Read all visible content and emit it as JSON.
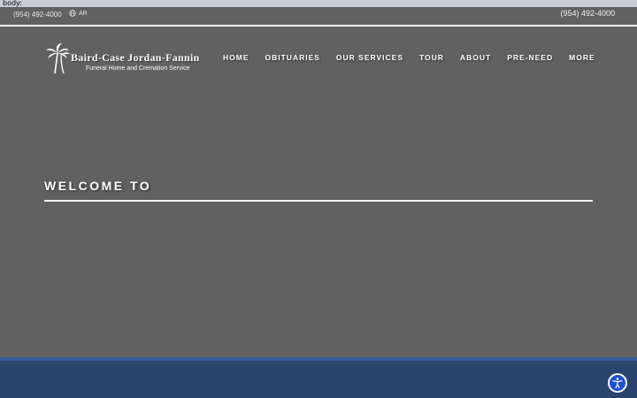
{
  "debug_label": "body:",
  "topbar": {
    "phone_left": "(954) 492-4000",
    "language": "AR",
    "phone_right": "(954) 492-4000"
  },
  "logo": {
    "name": "Baird-Case Jordan-Fannin",
    "subtitle": "Funeral Home and Cremation Service"
  },
  "nav": {
    "items": [
      "HOME",
      "OBITUARIES",
      "OUR SERVICES",
      "TOUR",
      "ABOUT",
      "PRE-NEED",
      "MORE"
    ]
  },
  "hero": {
    "heading": "WELCOME TO"
  },
  "colors": {
    "background": "#616161",
    "footer": "#2a4470",
    "accessibility_button": "#1d4fd8"
  },
  "icons": {
    "logo": "palm-tree-icon",
    "language": "globe-icon",
    "accessibility": "accessibility-icon"
  }
}
